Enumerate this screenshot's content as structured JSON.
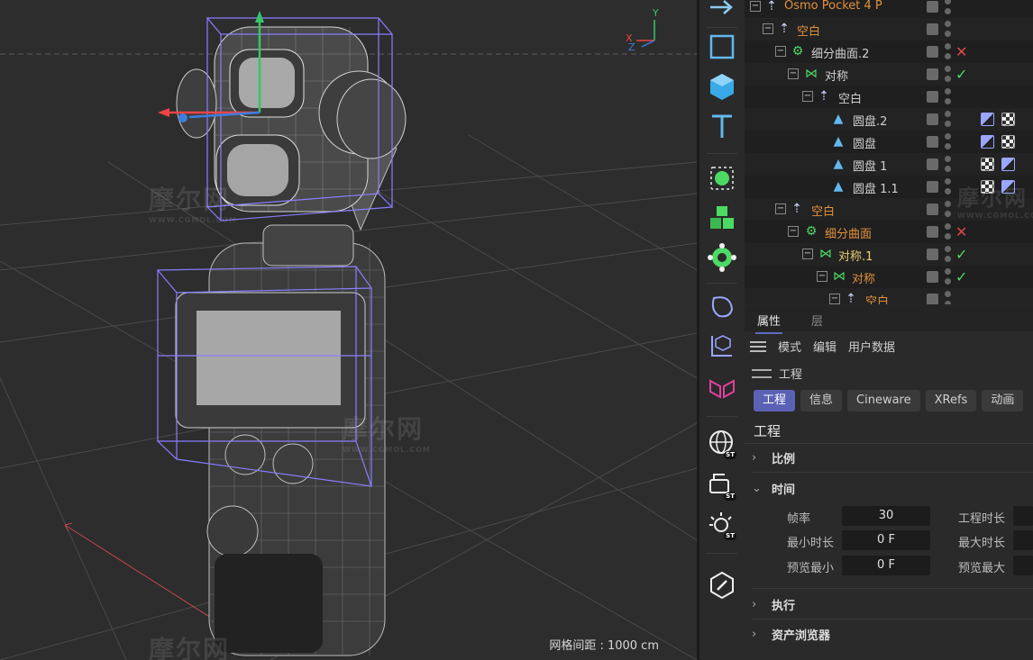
{
  "viewport": {
    "grid_spacing_label": "网格间距 : 1000 cm",
    "axis_labels": {
      "y": "Y",
      "x": "X",
      "z": "Z"
    },
    "watermarks": [
      {
        "text": "摩尔网",
        "sub": "WWW.CGMOL.COM"
      },
      {
        "text": "摩尔网",
        "sub": "WWW.CGMOL.COM"
      },
      {
        "text": "摩尔网",
        "sub": ""
      }
    ],
    "colors": {
      "background": "#2d2d2e",
      "wireframe": "#c8c8c8",
      "bounding_box": "#8a7dff"
    }
  },
  "toolbar": {
    "tools": [
      {
        "icon": "arrow-right-icon"
      },
      {
        "icon": "plane-icon"
      },
      {
        "icon": "cube-icon"
      },
      {
        "icon": "text-icon"
      },
      {
        "icon": "subdivision-icon"
      },
      {
        "icon": "blocks-icon"
      },
      {
        "icon": "gear-generator-icon"
      },
      {
        "icon": "deformer-icon"
      },
      {
        "icon": "null-axis-icon"
      },
      {
        "icon": "symmetry-icon"
      },
      {
        "icon": "globe-st-icon",
        "badge": "ST"
      },
      {
        "icon": "camera-st-icon",
        "badge": "ST"
      },
      {
        "icon": "light-st-icon",
        "badge": "ST"
      },
      {
        "icon": "pen-tag-icon"
      }
    ]
  },
  "objects": {
    "rows": [
      {
        "name": "Osmo Pocket 4 P",
        "color": "orange",
        "icon": "null-icon",
        "state": "",
        "tags": []
      },
      {
        "name": "空白",
        "color": "orange",
        "icon": "null-icon",
        "state": "",
        "tags": []
      },
      {
        "name": "细分曲面.2",
        "color": "white",
        "icon": "subdivision-icon",
        "state": "cross",
        "tags": []
      },
      {
        "name": "对称",
        "color": "white",
        "icon": "symmetry-icon",
        "state": "check",
        "tags": []
      },
      {
        "name": "空白",
        "color": "white",
        "icon": "null-icon",
        "state": "",
        "tags": []
      },
      {
        "name": "圆盘.2",
        "color": "white",
        "icon": "disc-icon",
        "state": "",
        "tags": [
          "corner",
          "checker"
        ]
      },
      {
        "name": "圆盘",
        "color": "white",
        "icon": "disc-icon",
        "state": "",
        "tags": [
          "corner",
          "checker"
        ]
      },
      {
        "name": "圆盘 1",
        "color": "white",
        "icon": "disc-icon",
        "state": "",
        "tags": [
          "checker",
          "corner"
        ]
      },
      {
        "name": "圆盘 1.1",
        "color": "white",
        "icon": "disc-icon",
        "state": "",
        "tags": [
          "checker",
          "corner"
        ]
      },
      {
        "name": "空白",
        "color": "orange",
        "icon": "null-icon",
        "state": "",
        "tags": []
      },
      {
        "name": "细分曲面",
        "color": "orange",
        "icon": "subdivision-icon",
        "state": "cross",
        "tags": []
      },
      {
        "name": "对称.1",
        "color": "yellow",
        "icon": "symmetry-icon",
        "state": "check",
        "tags": []
      },
      {
        "name": "对称",
        "color": "orange",
        "icon": "symmetry-icon",
        "state": "check",
        "tags": []
      },
      {
        "name": "空白",
        "color": "orange",
        "icon": "null-icon",
        "state": "",
        "tags": []
      }
    ]
  },
  "attributes": {
    "tabs": [
      "属性",
      "层"
    ],
    "menu": [
      "模式",
      "编辑",
      "用户数据"
    ],
    "object_title": "工程",
    "sub_tabs": [
      "工程",
      "信息",
      "Cineware",
      "XRefs",
      "动画"
    ],
    "section_title": "工程",
    "groups": {
      "scale": "比例",
      "time": "时间",
      "execute": "执行",
      "asset_browser": "资产浏览器"
    },
    "fields": {
      "fps_label": "帧率",
      "fps_value": "30",
      "project_length_label": "工程时长",
      "min_time_label": "最小时长",
      "min_time_value": "0 F",
      "max_time_label": "最大时长",
      "preview_min_label": "预览最小",
      "preview_min_value": "0 F",
      "preview_max_label": "预览最大"
    },
    "colors": {
      "accent": "#5b62b5"
    }
  }
}
